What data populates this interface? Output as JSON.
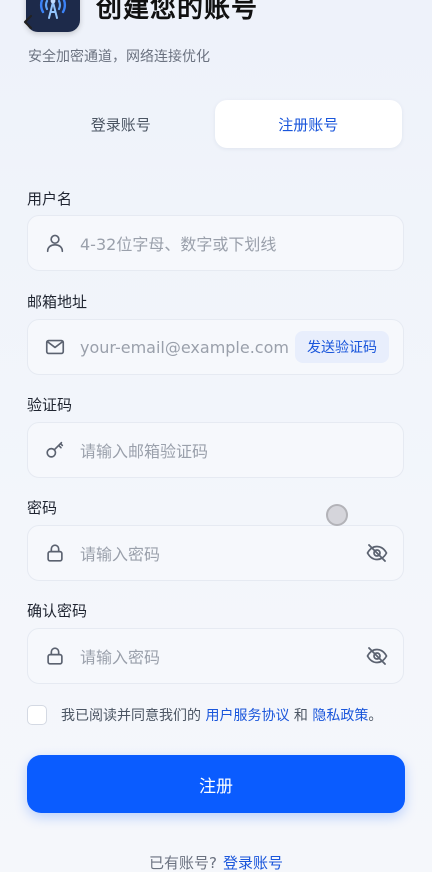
{
  "header": {
    "title": "创建您的账号",
    "subtitle": "安全加密通道，网络连接优化"
  },
  "tabs": [
    {
      "label": "登录账号",
      "active": false
    },
    {
      "label": "注册账号",
      "active": true
    }
  ],
  "form": {
    "username": {
      "label": "用户名",
      "placeholder": "4-32位字母、数字或下划线",
      "icon": "user-icon"
    },
    "email": {
      "label": "邮箱地址",
      "placeholder": "your-email@example.com",
      "icon": "mail-icon",
      "send_code_label": "发送验证码"
    },
    "code": {
      "label": "验证码",
      "placeholder": "请输入邮箱验证码",
      "icon": "key-icon"
    },
    "password": {
      "label": "密码",
      "placeholder": "请输入密码",
      "icon": "lock-icon"
    },
    "confirm_password": {
      "label": "确认密码",
      "placeholder": "请输入密码",
      "icon": "lock-icon"
    }
  },
  "agreement": {
    "prefix": "我已阅读并同意我们的 ",
    "terms_link": "用户服务协议",
    "middle": " 和 ",
    "privacy_link": "隐私政策",
    "suffix": "。"
  },
  "register_button": "注册",
  "footer": {
    "prompt": "已有账号?",
    "login_link": "登录账号"
  },
  "colors": {
    "primary": "#0a5cff",
    "link": "#1a56db",
    "logo_bg": "#1d2a4a"
  }
}
